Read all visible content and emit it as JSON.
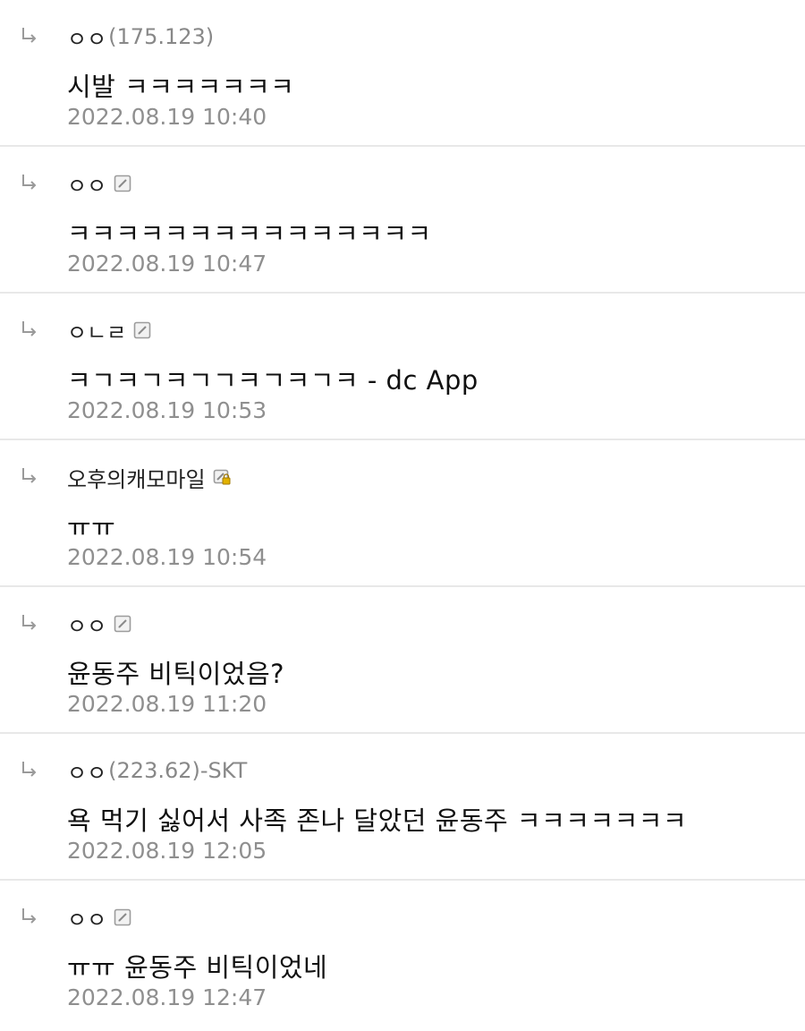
{
  "replies": [
    {
      "nickname": "ㅇㅇ",
      "ip": "(175.123)",
      "message": "시발 ㅋㅋㅋㅋㅋㅋㅋ",
      "date": "2022.08.19 10:40",
      "badge_icon": ""
    },
    {
      "nickname": "ㅇㅇ",
      "ip": "",
      "message": "ㅋㅋㅋㅋㅋㅋㅋㅋㅋㅋㅋㅋㅋㅋㅋ",
      "date": "2022.08.19 10:47",
      "badge_icon": "fixed-nick-icon"
    },
    {
      "nickname": "ㅇㄴㄹ",
      "ip": "",
      "message": "ㅋㄱㅋㄱㅋㄱㄱㅋㄱㅋㄱㅋ - dc App",
      "date": "2022.08.19 10:53",
      "badge_icon": "fixed-nick-icon"
    },
    {
      "nickname": "오후의캐모마일",
      "ip": "",
      "message": "ㅠㅠ",
      "date": "2022.08.19 10:54",
      "badge_icon": "fixed-nick-lock-icon"
    },
    {
      "nickname": "ㅇㅇ",
      "ip": "",
      "message": "윤동주 비틱이었음?",
      "date": "2022.08.19 11:20",
      "badge_icon": "fixed-nick-icon"
    },
    {
      "nickname": "ㅇㅇ",
      "ip": "(223.62)-SKT",
      "message": "욕 먹기 싫어서 사족 존나 달았던 윤동주 ㅋㅋㅋㅋㅋㅋㅋ",
      "date": "2022.08.19 12:05",
      "badge_icon": ""
    },
    {
      "nickname": "ㅇㅇ",
      "ip": "",
      "message": "ㅠㅠ 윤동주 비틱이었네",
      "date": "2022.08.19 12:47",
      "badge_icon": "fixed-nick-icon"
    }
  ],
  "colors": {
    "divider": "#e8e8e8",
    "date": "#8f8f8f",
    "ip": "#888888",
    "arrow": "#9a9a9a"
  },
  "icons": {
    "reply_arrow": "reply-arrow-icon"
  }
}
